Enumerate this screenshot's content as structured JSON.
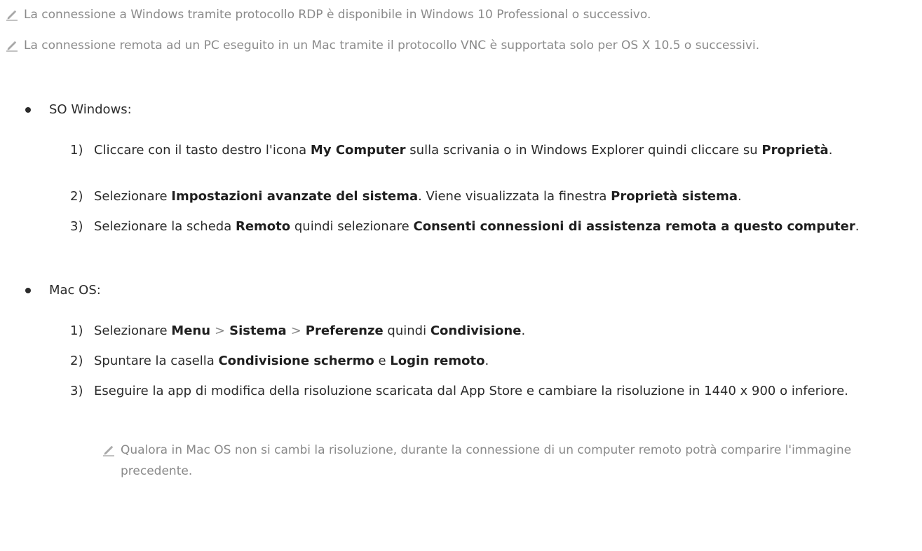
{
  "notes": {
    "rdp": "La connessione a Windows tramite protocollo RDP è disponibile in Windows 10 Professional o successivo.",
    "vnc": "La connessione remota ad un PC eseguito in un Mac tramite il protocollo VNC è supportata solo per OS X 10.5 o successivi.",
    "mac_resolution": "Qualora in Mac OS non si cambi la risoluzione, durante la connessione di un computer remoto potrà comparire l'immagine precedente."
  },
  "windows": {
    "heading": "SO Windows:",
    "step1": {
      "num": "1)",
      "t1": "Cliccare con il tasto destro l'icona ",
      "b1": "My Computer",
      "t2": " sulla scrivania o in Windows Explorer quindi cliccare su ",
      "b2": "Proprietà",
      "t3": "."
    },
    "step2": {
      "num": "2)",
      "t1": "Selezionare ",
      "b1": "Impostazioni avanzate del sistema",
      "t2": ". Viene visualizzata la finestra ",
      "b2": "Proprietà sistema",
      "t3": "."
    },
    "step3": {
      "num": "3)",
      "t1": "Selezionare la scheda ",
      "b1": "Remoto",
      "t2": " quindi selezionare ",
      "b2": "Consenti connessioni di assistenza remota a questo computer",
      "t3": "."
    }
  },
  "mac": {
    "heading": "Mac OS:",
    "step1": {
      "num": "1)",
      "t1": "Selezionare ",
      "b1": "Menu",
      "sep1": ">",
      "b2": "Sistema",
      "sep2": ">",
      "b3": "Preferenze",
      "t2": " quindi ",
      "b4": "Condivisione",
      "t3": "."
    },
    "step2": {
      "num": "2)",
      "t1": "Spuntare la casella ",
      "b1": "Condivisione schermo",
      "t2": " e ",
      "b2": "Login remoto",
      "t3": "."
    },
    "step3": {
      "num": "3)",
      "text": "Eseguire la app di modifica della risoluzione scaricata dal App Store e cambiare la risoluzione in 1440 x 900 o inferiore."
    }
  },
  "icons": {
    "note": "pencil-note-icon"
  },
  "colors": {
    "text": "#2b2b2b",
    "note_text": "#8a8a8a",
    "icon": "#a0a0a0"
  }
}
